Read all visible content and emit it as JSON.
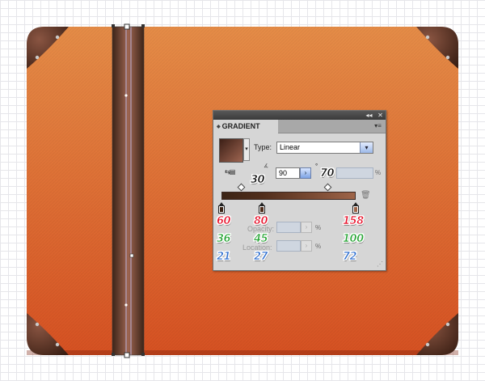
{
  "panel": {
    "title_tab": "GRADIENT",
    "type_label": "Type:",
    "type_value": "Linear",
    "angle_value": "90",
    "degree_mark": "°",
    "aspect_pct": "%",
    "opacity_label": "Opacity:",
    "location_label": "Location:",
    "percent": "%"
  },
  "annotations": {
    "angle": "30",
    "aspect": "70",
    "stops": [
      {
        "r": "60",
        "g": "36",
        "b": "21"
      },
      {
        "r": "80",
        "g": "45",
        "b": "27"
      },
      {
        "r": "158",
        "g": "100",
        "b": "72"
      }
    ]
  },
  "colors": {
    "case_top": "#e58c47",
    "case_bottom": "#d65122",
    "strap_dark": "#3c2418",
    "strap_light": "#9e6551",
    "annot_red": "#e8112a",
    "annot_green": "#27a535",
    "annot_blue": "#2f6fcf",
    "stop_1": "#3c2415",
    "stop_2": "#502d1b",
    "stop_3": "#9e6448"
  }
}
